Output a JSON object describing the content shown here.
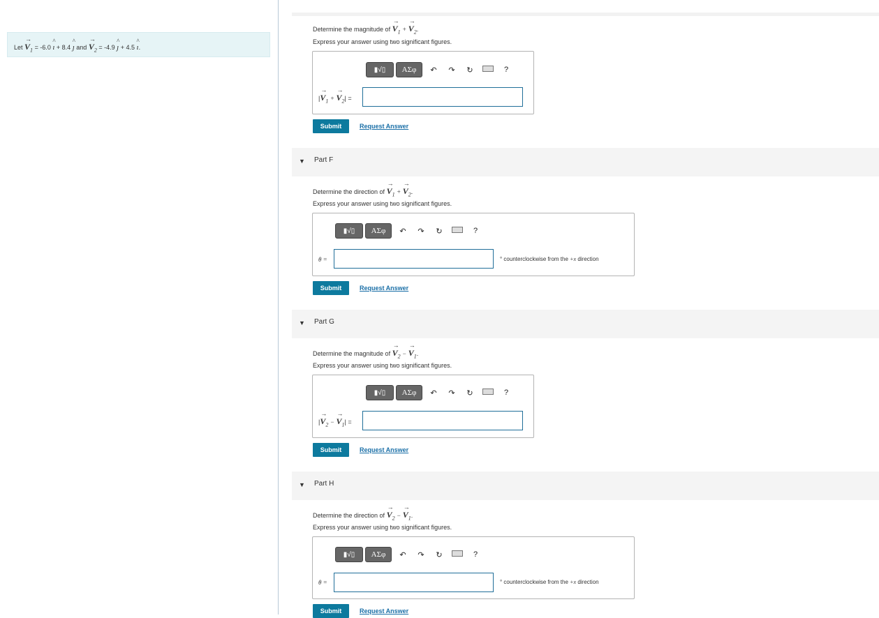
{
  "problem": {
    "prefix": "Let",
    "v1_label": "V",
    "v1_sub": "1",
    "eq1": "= -6.0",
    "i_hat": "ı",
    "plus1": "+ 8.4",
    "j_hat": "ȷ",
    "and": "and",
    "v2_label": "V",
    "v2_sub": "2",
    "eq2": "= -4.9",
    "plus2": "+ 4.5",
    "end": "."
  },
  "toolbar": {
    "templates_label": "▮√▯",
    "greek_label": "ΑΣφ",
    "undo": "↶",
    "redo": "↷",
    "reset": "↻",
    "help": "?"
  },
  "common": {
    "express": "Express your answer using two significant figures.",
    "submit": "Submit",
    "request": "Request Answer",
    "theta_label": "θ =",
    "unit_prefix": "° counterclockwise from the",
    "unit_dir": "+x",
    "unit_suffix": "direction"
  },
  "part_e": {
    "prompt": "Determine the magnitude of",
    "expr_a": "V",
    "expr_a_sub": "1",
    "op": "+",
    "expr_b": "V",
    "expr_b_sub": "2",
    "label_suffix": "="
  },
  "part_f": {
    "title": "Part F",
    "prompt": "Determine the direction of",
    "expr_a": "V",
    "expr_a_sub": "1",
    "op": "+",
    "expr_b": "V",
    "expr_b_sub": "2"
  },
  "part_g": {
    "title": "Part G",
    "prompt": "Determine the magnitude of",
    "expr_a": "V",
    "expr_a_sub": "2",
    "op": "−",
    "expr_b": "V",
    "expr_b_sub": "1",
    "label_suffix": "="
  },
  "part_h": {
    "title": "Part H",
    "prompt": "Determine the direction of",
    "expr_a": "V",
    "expr_a_sub": "2",
    "op": "−",
    "expr_b": "V",
    "expr_b_sub": "1"
  }
}
